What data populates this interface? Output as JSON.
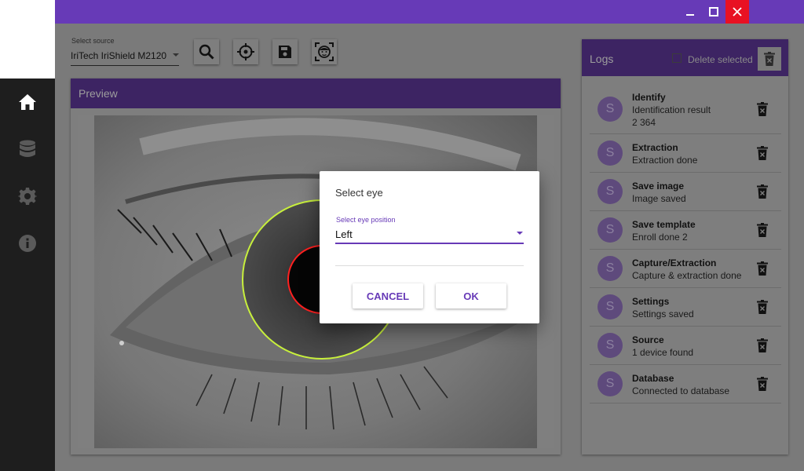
{
  "window": {
    "title_bar_color": "#673ab7",
    "buttons": {
      "minimize_icon": "minimize-icon",
      "maximize_icon": "maximize-icon",
      "close_icon": "close-icon"
    }
  },
  "nav": {
    "items": [
      {
        "icon": "home-icon",
        "active": true
      },
      {
        "icon": "database-icon",
        "active": false
      },
      {
        "icon": "gear-icon",
        "active": false
      },
      {
        "icon": "info-icon",
        "active": false
      }
    ]
  },
  "source": {
    "label": "Select source",
    "value": "IriTech IriShield M2120"
  },
  "toolbar": {
    "icons": [
      "search-icon",
      "crosshair-icon",
      "save-icon",
      "face-scan-icon"
    ]
  },
  "preview": {
    "title": "Preview"
  },
  "logs": {
    "title": "Logs",
    "delete_selected_label": "Delete selected",
    "items": [
      {
        "avatar": "S",
        "title": "Identify",
        "subtitle": "Identification result",
        "detail": "2 364"
      },
      {
        "avatar": "S",
        "title": "Extraction",
        "subtitle": "Extraction done"
      },
      {
        "avatar": "S",
        "title": "Save image",
        "subtitle": "Image saved"
      },
      {
        "avatar": "S",
        "title": "Save template",
        "subtitle": "Enroll done 2"
      },
      {
        "avatar": "S",
        "title": "Capture/Extraction",
        "subtitle": "Capture & extraction done"
      },
      {
        "avatar": "S",
        "title": "Settings",
        "subtitle": "Settings saved"
      },
      {
        "avatar": "S",
        "title": "Source",
        "subtitle": "1 device found"
      },
      {
        "avatar": "S",
        "title": "Database",
        "subtitle": "Connected to database"
      }
    ]
  },
  "dialog": {
    "title": "Select eye",
    "field_label": "Select eye position",
    "field_value": "Left",
    "cancel_label": "CANCEL",
    "ok_label": "OK",
    "accent_color": "#673ab7"
  }
}
